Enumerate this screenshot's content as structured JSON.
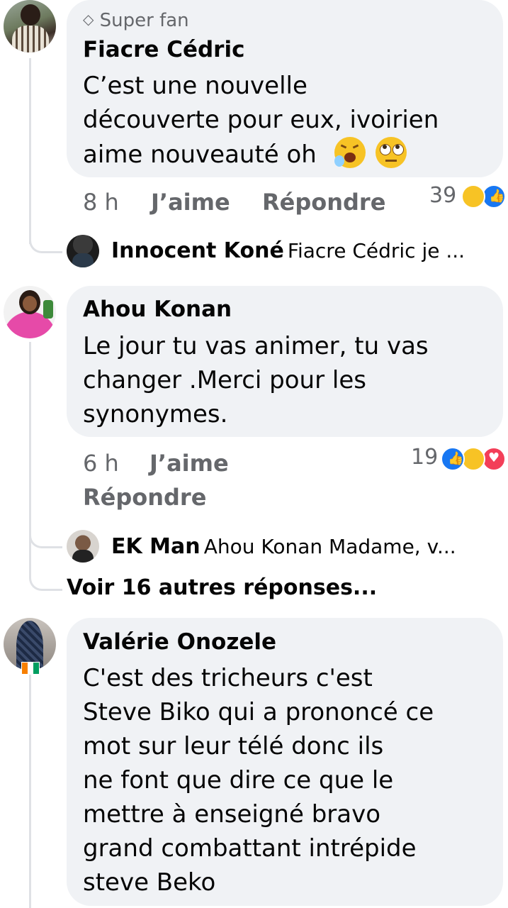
{
  "comments": [
    {
      "badge": "Super fan",
      "author": "Fiacre Cédric",
      "lines": [
        "C’est une nouvelle",
        "découverte pour eux, ivoirien",
        "aime nouveauté oh"
      ],
      "time": "8 h",
      "like_label": "J’aime",
      "reply_label": "Répondre",
      "reaction_count": "39",
      "reply": {
        "author": "Innocent Koné",
        "preview": "Fiacre Cédric je ..."
      }
    },
    {
      "author": "Ahou Konan",
      "lines": [
        "Le jour tu vas animer,  tu vas",
        "changer .Merci pour les",
        "synonymes."
      ],
      "time": "6 h",
      "like_label": "J’aime",
      "reply_label": "Répondre",
      "reaction_count": "19",
      "reply": {
        "author": "EK Man",
        "preview": "Ahou Konan Madame, v..."
      },
      "more_replies": "Voir 16 autres réponses..."
    },
    {
      "author": "Valérie Onozele",
      "lines": [
        "C'est des tricheurs  c'est",
        "Steve Biko qui a prononcé ce",
        "mot sur leur télé donc ils",
        "ne font que dire ce que le",
        "mettre à enseigné  bravo",
        "grand combattant intrépide",
        "steve Beko"
      ]
    }
  ],
  "colors": {
    "bubble": "#f0f2f5",
    "meta": "#65676b",
    "like_blue": "#1877f2",
    "love_red": "#f33e58",
    "haha_yellow": "#f7c325"
  }
}
